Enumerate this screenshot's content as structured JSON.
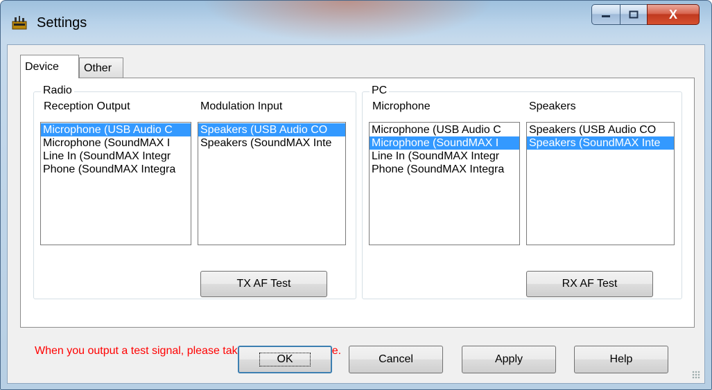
{
  "window": {
    "title": "Settings"
  },
  "titlebar_buttons": {
    "minimize": "▁",
    "maximize": "□",
    "close": "X"
  },
  "tabs": [
    {
      "label": "Device",
      "active": true
    },
    {
      "label": "Other",
      "active": false
    }
  ],
  "radio": {
    "legend": "Radio",
    "reception_output": {
      "label": "Reception Output",
      "items": [
        "Microphone (USB Audio C",
        "Microphone (SoundMAX I",
        "Line In (SoundMAX Integr",
        "Phone (SoundMAX Integra"
      ],
      "selected": 0
    },
    "modulation_input": {
      "label": "Modulation Input",
      "items": [
        "Speakers (USB Audio CO",
        "Speakers (SoundMAX Inte"
      ],
      "selected": 0
    },
    "test_button": "TX AF Test"
  },
  "pc": {
    "legend": "PC",
    "microphone": {
      "label": "Microphone",
      "items": [
        "Microphone (USB Audio C",
        "Microphone (SoundMAX I",
        "Line In (SoundMAX Integr",
        "Phone (SoundMAX Integra"
      ],
      "selected": 1
    },
    "speakers": {
      "label": "Speakers",
      "items": [
        "Speakers (USB Audio CO",
        "Speakers (SoundMAX Inte"
      ],
      "selected": 1
    },
    "test_button": "RX AF Test"
  },
  "warning": "When you output a test signal, please take care about volume.",
  "buttons": {
    "ok": "OK",
    "cancel": "Cancel",
    "apply": "Apply",
    "help": "Help"
  },
  "colors": {
    "selection": "#3399ff",
    "warning": "#ff0000"
  }
}
